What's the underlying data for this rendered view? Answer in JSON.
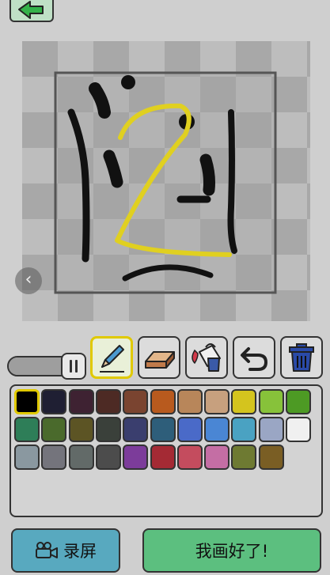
{
  "header": {
    "back_icon": "arrow-left-icon"
  },
  "canvas": {
    "nav_icon": "chevron-left-icon",
    "nav_glyph": "‹",
    "ink_colors": [
      "#111111",
      "#e0d020"
    ]
  },
  "brush_size": {
    "level": 0.72
  },
  "tools": [
    {
      "name": "pencil-tool",
      "icon": "pencil-icon",
      "selected": true
    },
    {
      "name": "eraser-tool",
      "icon": "eraser-icon",
      "selected": false
    },
    {
      "name": "fill-tool",
      "icon": "paint-bucket-icon",
      "selected": false
    },
    {
      "name": "undo-tool",
      "icon": "undo-icon",
      "selected": false
    },
    {
      "name": "delete-tool",
      "icon": "trash-icon",
      "selected": false
    }
  ],
  "palette": {
    "selected_index": 0,
    "rows": [
      [
        "#000000",
        "#1f1f33",
        "#3e2232",
        "#4d2a24",
        "#7a4430",
        "#b85a1e",
        "#b8865a",
        "#c7a07e",
        "#d4c41e",
        "#87c23a",
        "#4d9a24"
      ],
      [
        "#2e7e58",
        "#4a6a2c",
        "#5c5424",
        "#3a403a",
        "#3a3e6e",
        "#2e5e7a",
        "#4a6ac8",
        "#4a86d4",
        "#4aa2c2",
        "#9aa6c4",
        "#f0f0f0"
      ],
      [
        "#8a98a0",
        "#74747c",
        "#626a68",
        "#4c4c4c",
        "#7c3c9a",
        "#a42a34",
        "#c44c5e",
        "#c46ea4",
        "#6e7a32",
        "#7a5e24"
      ]
    ]
  },
  "actions": {
    "record_label": "录屏",
    "record_icon": "video-camera-icon",
    "done_label": "我画好了!"
  }
}
